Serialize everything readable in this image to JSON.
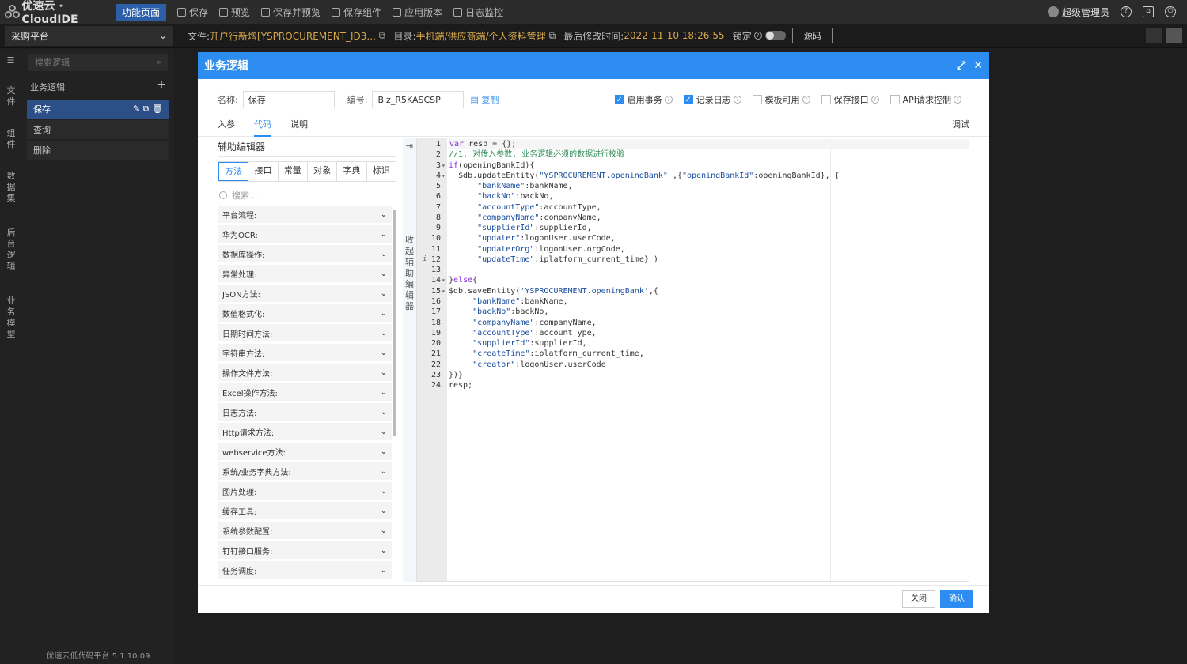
{
  "topbar": {
    "brand": "优速云 · CloudIDE",
    "function_page": "功能页面",
    "tools": [
      "保存",
      "预览",
      "保存并预览",
      "保存组件",
      "应用版本",
      "日志监控"
    ],
    "user": "超级管理员"
  },
  "bar2": {
    "platform": "采购平台",
    "file_label": "文件:",
    "file_value": "开户行新增[YSPROCUREMENT_ID3...",
    "dir_label": "目录:",
    "dir_value": "手机端/供应商端/个人资料管理",
    "modified_label": "最后修改时间:",
    "modified_value": "2022-11-10 18:26:55",
    "lock_label": "锁定",
    "source_btn": "源码"
  },
  "rail": [
    "文件",
    "组件",
    "数据集",
    "后台逻辑",
    "业务模型"
  ],
  "lpanel": {
    "search_placeholder": "搜索逻辑",
    "group": "业务逻辑",
    "items": [
      "保存",
      "查询",
      "删除"
    ],
    "version": "优速云低代码平台 5.1.10.09"
  },
  "modal": {
    "title": "业务逻辑",
    "name_label": "名称:",
    "name_value": "保存",
    "code_label": "编号:",
    "code_value": "Biz_R5KASCSP",
    "copy": "复制",
    "checks": [
      {
        "label": "启用事务",
        "on": true
      },
      {
        "label": "记录日志",
        "on": true
      },
      {
        "label": "模板可用",
        "on": false
      },
      {
        "label": "保存接口",
        "on": false
      },
      {
        "label": "API请求控制",
        "on": false
      }
    ],
    "tabs": [
      "入参",
      "代码",
      "说明"
    ],
    "debug": "调试",
    "helper_title": "辅助编辑器",
    "helper_tabs": [
      "方法",
      "接口",
      "常量",
      "对象",
      "字典",
      "标识"
    ],
    "helper_search": "搜索...",
    "helper_items": [
      "平台流程:",
      "华为OCR:",
      "数据库操作:",
      "异常处理:",
      "JSON方法:",
      "数值格式化:",
      "日期时间方法:",
      "字符串方法:",
      "操作文件方法:",
      "Excel操作方法:",
      "日志方法:",
      "Http请求方法:",
      "webservice方法:",
      "系统/业务字典方法:",
      "图片处理:",
      "缓存工具:",
      "系统参数配置:",
      "钉钉接口服务:",
      "任务调度:"
    ],
    "collapse_text": "收起辅助编辑器",
    "close_btn": "关闭",
    "confirm_btn": "确认"
  },
  "code_lines": [
    "var resp = {};",
    "//1, 对传入参数, 业务逻辑必须的数据进行校验",
    "if(openingBankId){",
    "  $db.updateEntity(\"YSPROCUREMENT.openingBank\" ,{\"openingBankId\":openingBankId}, {",
    "      \"bankName\":bankName,",
    "      \"backNo\":backNo,",
    "      \"accountType\":accountType,",
    "      \"companyName\":companyName,",
    "      \"supplierId\":supplierId,",
    "      \"updater\":logonUser.userCode,",
    "      \"updaterOrg\":logonUser.orgCode,",
    "      \"updateTime\":iplatform_current_time} )",
    "",
    "}else{",
    "$db.saveEntity('YSPROCUREMENT.openingBank',{",
    "     \"bankName\":bankName,",
    "     \"backNo\":backNo,",
    "     \"companyName\":companyName,",
    "     \"accountType\":accountType,",
    "     \"supplierId\":supplierId,",
    "     \"createTime\":iplatform_current_time,",
    "     \"creator\":logonUser.userCode",
    "})}",
    "resp;"
  ]
}
